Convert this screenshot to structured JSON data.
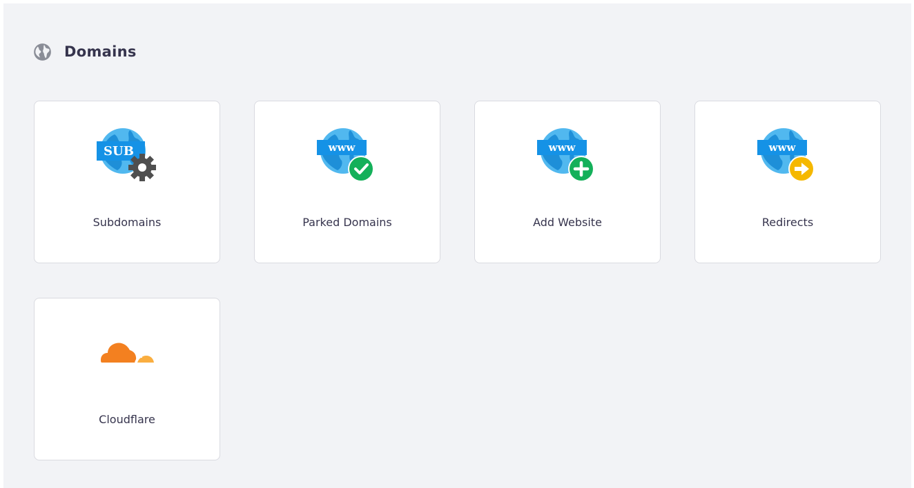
{
  "section": {
    "title": "Domains",
    "icon": "globe-icon"
  },
  "tiles": [
    {
      "label": "Subdomains",
      "icon": "subdomain-gear-icon"
    },
    {
      "label": "Parked Domains",
      "icon": "www-check-icon"
    },
    {
      "label": "Add Website",
      "icon": "www-plus-icon"
    },
    {
      "label": "Redirects",
      "icon": "www-arrow-icon"
    },
    {
      "label": "Cloudflare",
      "icon": "cloudflare-icon"
    }
  ],
  "icon_text": {
    "sub": "SUB",
    "www": "www"
  },
  "colors": {
    "background": "#f2f3f6",
    "globe_blue": "#51b8ef",
    "banner_blue": "#1592e6",
    "check_green": "#14b05a",
    "arrow_yellow": "#f5b800",
    "gear_gray": "#4f4f4f",
    "cloudflare_orange": "#f38020",
    "cloudflare_light": "#faae40"
  }
}
